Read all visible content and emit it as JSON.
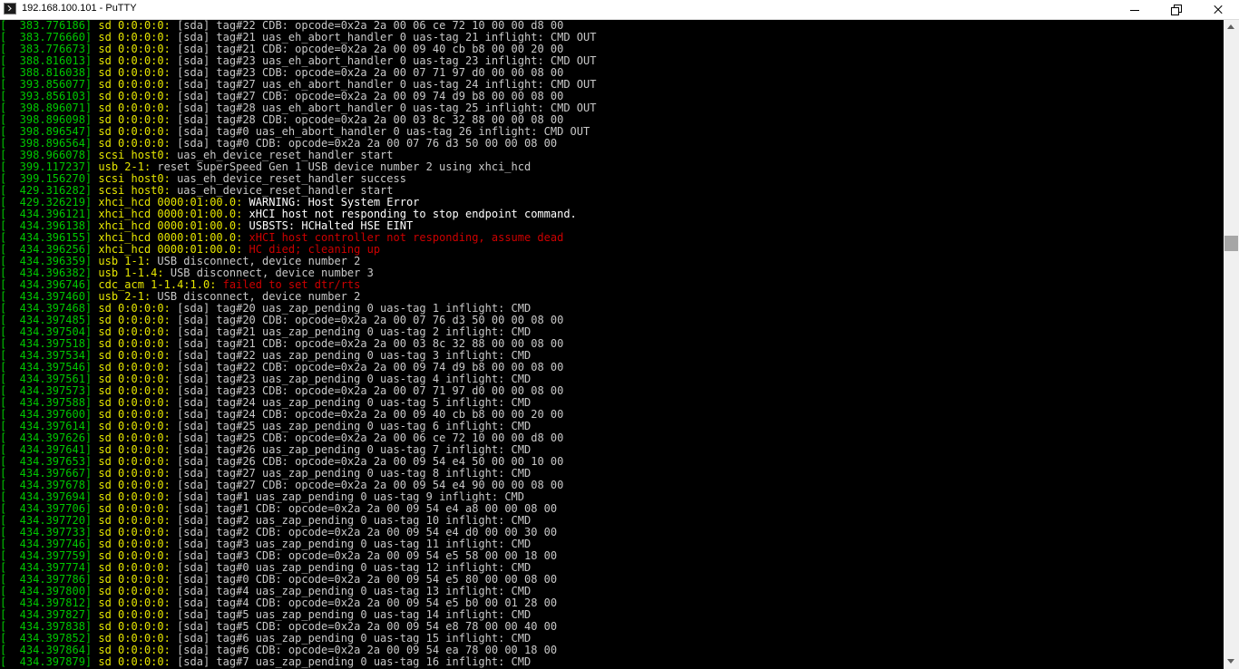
{
  "window": {
    "title": "192.168.100.101 - PuTTY",
    "icon": "putty-terminal-icon"
  },
  "colors": {
    "timestamp": "#00c800",
    "device": "#e6e600",
    "text": "#c8c8c8",
    "bright": "#ffffff",
    "error": "#cc0000"
  },
  "lines": [
    [
      [
        "[  383.776186] ",
        "t"
      ],
      [
        "sd 0:0:0:0:",
        "d"
      ],
      [
        " [sda] tag#22 CDB: opcode=0x2a 2a 00 06 ce 72 10 00 00 d8 00",
        "n"
      ]
    ],
    [
      [
        "[  383.776660] ",
        "t"
      ],
      [
        "sd 0:0:0:0:",
        "d"
      ],
      [
        " [sda] tag#21 uas_eh_abort_handler 0 uas-tag 21 inflight: CMD OUT",
        "n"
      ]
    ],
    [
      [
        "[  383.776673] ",
        "t"
      ],
      [
        "sd 0:0:0:0:",
        "d"
      ],
      [
        " [sda] tag#21 CDB: opcode=0x2a 2a 00 09 40 cb b8 00 00 20 00",
        "n"
      ]
    ],
    [
      [
        "[  388.816013] ",
        "t"
      ],
      [
        "sd 0:0:0:0:",
        "d"
      ],
      [
        " [sda] tag#23 uas_eh_abort_handler 0 uas-tag 23 inflight: CMD OUT",
        "n"
      ]
    ],
    [
      [
        "[  388.816038] ",
        "t"
      ],
      [
        "sd 0:0:0:0:",
        "d"
      ],
      [
        " [sda] tag#23 CDB: opcode=0x2a 2a 00 07 71 97 d0 00 00 08 00",
        "n"
      ]
    ],
    [
      [
        "[  393.856077] ",
        "t"
      ],
      [
        "sd 0:0:0:0:",
        "d"
      ],
      [
        " [sda] tag#27 uas_eh_abort_handler 0 uas-tag 24 inflight: CMD OUT",
        "n"
      ]
    ],
    [
      [
        "[  393.856103] ",
        "t"
      ],
      [
        "sd 0:0:0:0:",
        "d"
      ],
      [
        " [sda] tag#27 CDB: opcode=0x2a 2a 00 09 74 d9 b8 00 00 08 00",
        "n"
      ]
    ],
    [
      [
        "[  398.896071] ",
        "t"
      ],
      [
        "sd 0:0:0:0:",
        "d"
      ],
      [
        " [sda] tag#28 uas_eh_abort_handler 0 uas-tag 25 inflight: CMD OUT",
        "n"
      ]
    ],
    [
      [
        "[  398.896098] ",
        "t"
      ],
      [
        "sd 0:0:0:0:",
        "d"
      ],
      [
        " [sda] tag#28 CDB: opcode=0x2a 2a 00 03 8c 32 88 00 00 08 00",
        "n"
      ]
    ],
    [
      [
        "[  398.896547] ",
        "t"
      ],
      [
        "sd 0:0:0:0:",
        "d"
      ],
      [
        " [sda] tag#0 uas_eh_abort_handler 0 uas-tag 26 inflight: CMD OUT",
        "n"
      ]
    ],
    [
      [
        "[  398.896564] ",
        "t"
      ],
      [
        "sd 0:0:0:0:",
        "d"
      ],
      [
        " [sda] tag#0 CDB: opcode=0x2a 2a 00 07 76 d3 50 00 00 08 00",
        "n"
      ]
    ],
    [
      [
        "[  398.966078] ",
        "t"
      ],
      [
        "scsi host0:",
        "d"
      ],
      [
        " uas_eh_device_reset_handler start",
        "n"
      ]
    ],
    [
      [
        "[  399.117237] ",
        "t"
      ],
      [
        "usb 2-1:",
        "d"
      ],
      [
        " reset SuperSpeed Gen 1 USB device number 2 using xhci_hcd",
        "n"
      ]
    ],
    [
      [
        "[  399.156270] ",
        "t"
      ],
      [
        "scsi host0:",
        "d"
      ],
      [
        " uas_eh_device_reset_handler success",
        "n"
      ]
    ],
    [
      [
        "[  429.316282] ",
        "t"
      ],
      [
        "scsi host0:",
        "d"
      ],
      [
        " uas_eh_device_reset_handler start",
        "n"
      ]
    ],
    [
      [
        "[  429.326219] ",
        "t"
      ],
      [
        "xhci_hcd 0000:01:00.0:",
        "d"
      ],
      [
        " WARNING: Host System Error",
        "b"
      ]
    ],
    [
      [
        "[  434.396121] ",
        "t"
      ],
      [
        "xhci_hcd 0000:01:00.0:",
        "d"
      ],
      [
        " xHCI host not responding to stop endpoint command.",
        "b"
      ]
    ],
    [
      [
        "[  434.396138] ",
        "t"
      ],
      [
        "xhci_hcd 0000:01:00.0:",
        "d"
      ],
      [
        " USBSTS: HCHalted HSE EINT",
        "b"
      ]
    ],
    [
      [
        "[  434.396155] ",
        "t"
      ],
      [
        "xhci_hcd 0000:01:00.0:",
        "d"
      ],
      [
        " xHCI host controller not responding, assume dead",
        "e"
      ]
    ],
    [
      [
        "[  434.396256] ",
        "t"
      ],
      [
        "xhci_hcd 0000:01:00.0:",
        "d"
      ],
      [
        " HC died; cleaning up",
        "e"
      ]
    ],
    [
      [
        "[  434.396359] ",
        "t"
      ],
      [
        "usb 1-1:",
        "d"
      ],
      [
        " USB disconnect, device number 2",
        "n"
      ]
    ],
    [
      [
        "[  434.396382] ",
        "t"
      ],
      [
        "usb 1-1.4:",
        "d"
      ],
      [
        " USB disconnect, device number 3",
        "n"
      ]
    ],
    [
      [
        "[  434.396746] ",
        "t"
      ],
      [
        "cdc_acm 1-1.4:1.0:",
        "d"
      ],
      [
        " failed to set dtr/rts",
        "e"
      ]
    ],
    [
      [
        "[  434.397460] ",
        "t"
      ],
      [
        "usb 2-1:",
        "d"
      ],
      [
        " USB disconnect, device number 2",
        "n"
      ]
    ],
    [
      [
        "[  434.397468] ",
        "t"
      ],
      [
        "sd 0:0:0:0:",
        "d"
      ],
      [
        " [sda] tag#20 uas_zap_pending 0 uas-tag 1 inflight: CMD",
        "n"
      ]
    ],
    [
      [
        "[  434.397485] ",
        "t"
      ],
      [
        "sd 0:0:0:0:",
        "d"
      ],
      [
        " [sda] tag#20 CDB: opcode=0x2a 2a 00 07 76 d3 50 00 00 08 00",
        "n"
      ]
    ],
    [
      [
        "[  434.397504] ",
        "t"
      ],
      [
        "sd 0:0:0:0:",
        "d"
      ],
      [
        " [sda] tag#21 uas_zap_pending 0 uas-tag 2 inflight: CMD",
        "n"
      ]
    ],
    [
      [
        "[  434.397518] ",
        "t"
      ],
      [
        "sd 0:0:0:0:",
        "d"
      ],
      [
        " [sda] tag#21 CDB: opcode=0x2a 2a 00 03 8c 32 88 00 00 08 00",
        "n"
      ]
    ],
    [
      [
        "[  434.397534] ",
        "t"
      ],
      [
        "sd 0:0:0:0:",
        "d"
      ],
      [
        " [sda] tag#22 uas_zap_pending 0 uas-tag 3 inflight: CMD",
        "n"
      ]
    ],
    [
      [
        "[  434.397546] ",
        "t"
      ],
      [
        "sd 0:0:0:0:",
        "d"
      ],
      [
        " [sda] tag#22 CDB: opcode=0x2a 2a 00 09 74 d9 b8 00 00 08 00",
        "n"
      ]
    ],
    [
      [
        "[  434.397561] ",
        "t"
      ],
      [
        "sd 0:0:0:0:",
        "d"
      ],
      [
        " [sda] tag#23 uas_zap_pending 0 uas-tag 4 inflight: CMD",
        "n"
      ]
    ],
    [
      [
        "[  434.397573] ",
        "t"
      ],
      [
        "sd 0:0:0:0:",
        "d"
      ],
      [
        " [sda] tag#23 CDB: opcode=0x2a 2a 00 07 71 97 d0 00 00 08 00",
        "n"
      ]
    ],
    [
      [
        "[  434.397588] ",
        "t"
      ],
      [
        "sd 0:0:0:0:",
        "d"
      ],
      [
        " [sda] tag#24 uas_zap_pending 0 uas-tag 5 inflight: CMD",
        "n"
      ]
    ],
    [
      [
        "[  434.397600] ",
        "t"
      ],
      [
        "sd 0:0:0:0:",
        "d"
      ],
      [
        " [sda] tag#24 CDB: opcode=0x2a 2a 00 09 40 cb b8 00 00 20 00",
        "n"
      ]
    ],
    [
      [
        "[  434.397614] ",
        "t"
      ],
      [
        "sd 0:0:0:0:",
        "d"
      ],
      [
        " [sda] tag#25 uas_zap_pending 0 uas-tag 6 inflight: CMD",
        "n"
      ]
    ],
    [
      [
        "[  434.397626] ",
        "t"
      ],
      [
        "sd 0:0:0:0:",
        "d"
      ],
      [
        " [sda] tag#25 CDB: opcode=0x2a 2a 00 06 ce 72 10 00 00 d8 00",
        "n"
      ]
    ],
    [
      [
        "[  434.397641] ",
        "t"
      ],
      [
        "sd 0:0:0:0:",
        "d"
      ],
      [
        " [sda] tag#26 uas_zap_pending 0 uas-tag 7 inflight: CMD",
        "n"
      ]
    ],
    [
      [
        "[  434.397653] ",
        "t"
      ],
      [
        "sd 0:0:0:0:",
        "d"
      ],
      [
        " [sda] tag#26 CDB: opcode=0x2a 2a 00 09 54 e4 50 00 00 10 00",
        "n"
      ]
    ],
    [
      [
        "[  434.397667] ",
        "t"
      ],
      [
        "sd 0:0:0:0:",
        "d"
      ],
      [
        " [sda] tag#27 uas_zap_pending 0 uas-tag 8 inflight: CMD",
        "n"
      ]
    ],
    [
      [
        "[  434.397678] ",
        "t"
      ],
      [
        "sd 0:0:0:0:",
        "d"
      ],
      [
        " [sda] tag#27 CDB: opcode=0x2a 2a 00 09 54 e4 90 00 00 08 00",
        "n"
      ]
    ],
    [
      [
        "[  434.397694] ",
        "t"
      ],
      [
        "sd 0:0:0:0:",
        "d"
      ],
      [
        " [sda] tag#1 uas_zap_pending 0 uas-tag 9 inflight: CMD",
        "n"
      ]
    ],
    [
      [
        "[  434.397706] ",
        "t"
      ],
      [
        "sd 0:0:0:0:",
        "d"
      ],
      [
        " [sda] tag#1 CDB: opcode=0x2a 2a 00 09 54 e4 a8 00 00 08 00",
        "n"
      ]
    ],
    [
      [
        "[  434.397720] ",
        "t"
      ],
      [
        "sd 0:0:0:0:",
        "d"
      ],
      [
        " [sda] tag#2 uas_zap_pending 0 uas-tag 10 inflight: CMD",
        "n"
      ]
    ],
    [
      [
        "[  434.397733] ",
        "t"
      ],
      [
        "sd 0:0:0:0:",
        "d"
      ],
      [
        " [sda] tag#2 CDB: opcode=0x2a 2a 00 09 54 e4 d0 00 00 30 00",
        "n"
      ]
    ],
    [
      [
        "[  434.397746] ",
        "t"
      ],
      [
        "sd 0:0:0:0:",
        "d"
      ],
      [
        " [sda] tag#3 uas_zap_pending 0 uas-tag 11 inflight: CMD",
        "n"
      ]
    ],
    [
      [
        "[  434.397759] ",
        "t"
      ],
      [
        "sd 0:0:0:0:",
        "d"
      ],
      [
        " [sda] tag#3 CDB: opcode=0x2a 2a 00 09 54 e5 58 00 00 18 00",
        "n"
      ]
    ],
    [
      [
        "[  434.397774] ",
        "t"
      ],
      [
        "sd 0:0:0:0:",
        "d"
      ],
      [
        " [sda] tag#0 uas_zap_pending 0 uas-tag 12 inflight: CMD",
        "n"
      ]
    ],
    [
      [
        "[  434.397786] ",
        "t"
      ],
      [
        "sd 0:0:0:0:",
        "d"
      ],
      [
        " [sda] tag#0 CDB: opcode=0x2a 2a 00 09 54 e5 80 00 00 08 00",
        "n"
      ]
    ],
    [
      [
        "[  434.397800] ",
        "t"
      ],
      [
        "sd 0:0:0:0:",
        "d"
      ],
      [
        " [sda] tag#4 uas_zap_pending 0 uas-tag 13 inflight: CMD",
        "n"
      ]
    ],
    [
      [
        "[  434.397812] ",
        "t"
      ],
      [
        "sd 0:0:0:0:",
        "d"
      ],
      [
        " [sda] tag#4 CDB: opcode=0x2a 2a 00 09 54 e5 b0 00 01 28 00",
        "n"
      ]
    ],
    [
      [
        "[  434.397827] ",
        "t"
      ],
      [
        "sd 0:0:0:0:",
        "d"
      ],
      [
        " [sda] tag#5 uas_zap_pending 0 uas-tag 14 inflight: CMD",
        "n"
      ]
    ],
    [
      [
        "[  434.397838] ",
        "t"
      ],
      [
        "sd 0:0:0:0:",
        "d"
      ],
      [
        " [sda] tag#5 CDB: opcode=0x2a 2a 00 09 54 e8 78 00 00 40 00",
        "n"
      ]
    ],
    [
      [
        "[  434.397852] ",
        "t"
      ],
      [
        "sd 0:0:0:0:",
        "d"
      ],
      [
        " [sda] tag#6 uas_zap_pending 0 uas-tag 15 inflight: CMD",
        "n"
      ]
    ],
    [
      [
        "[  434.397864] ",
        "t"
      ],
      [
        "sd 0:0:0:0:",
        "d"
      ],
      [
        " [sda] tag#6 CDB: opcode=0x2a 2a 00 09 54 ea 78 00 00 18 00",
        "n"
      ]
    ],
    [
      [
        "[  434.397879] ",
        "t"
      ],
      [
        "sd 0:0:0:0:",
        "d"
      ],
      [
        " [sda] tag#7 uas_zap_pending 0 uas-tag 16 inflight: CMD",
        "n"
      ]
    ]
  ]
}
